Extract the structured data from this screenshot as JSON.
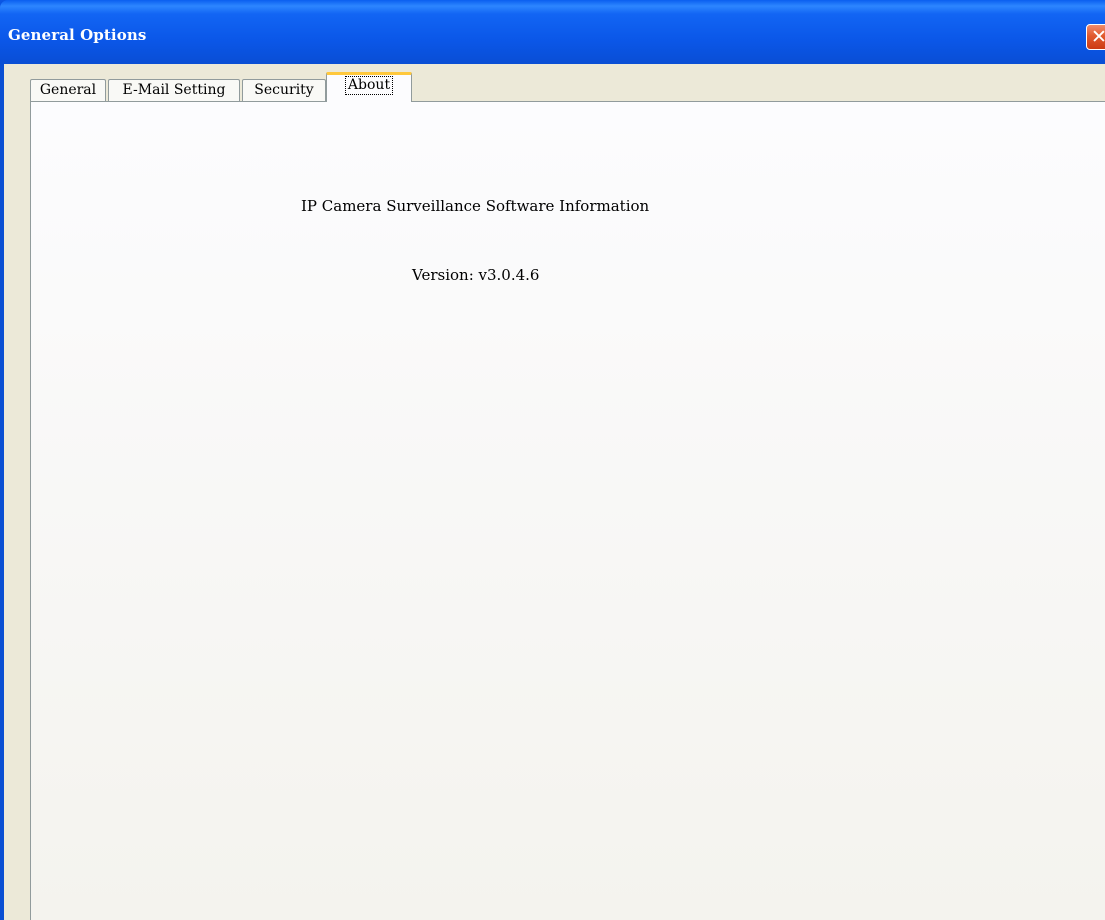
{
  "window": {
    "title": "General Options",
    "close_glyph": "✕"
  },
  "tabs": [
    {
      "label": "General",
      "selected": false
    },
    {
      "label": "E-Mail Setting",
      "selected": false
    },
    {
      "label": "Security",
      "selected": false
    },
    {
      "label": "About",
      "selected": true
    }
  ],
  "about": {
    "info_title": "IP Camera Surveillance Software Information",
    "version": "Version: v3.0.4.6"
  },
  "colors": {
    "titlebar": "#0a55e3",
    "selected_tab_accent": "#ffc83c",
    "close_button": "#e15a2e"
  }
}
